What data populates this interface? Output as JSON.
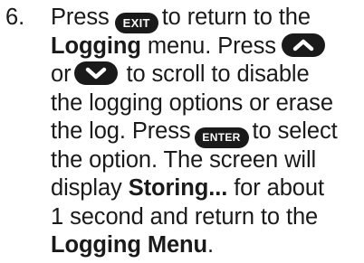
{
  "step": {
    "number": "6.",
    "segments": {
      "s01": "Press",
      "key_exit": "EXIT",
      "s02": "to return to the",
      "logging": "Logging",
      "s03": "menu. Press",
      "s04": "or",
      "s05": "to scroll to disable",
      "s06": "the logging options or erase",
      "s07": "the log. Press",
      "key_enter": "ENTER",
      "s08": "to select",
      "s09": "the option. The screen will",
      "s10": "display",
      "storing": "Storing...",
      "s11": "for about",
      "s12": "1 second and return to the",
      "logging_menu": "Logging Menu",
      "s13": "."
    },
    "icons": {
      "up": "up-arrow-key-icon",
      "down": "down-arrow-key-icon"
    }
  },
  "colors": {
    "text": "#1a1a1a",
    "key_background": "#1a1a1a",
    "key_text": "#ffffff"
  }
}
